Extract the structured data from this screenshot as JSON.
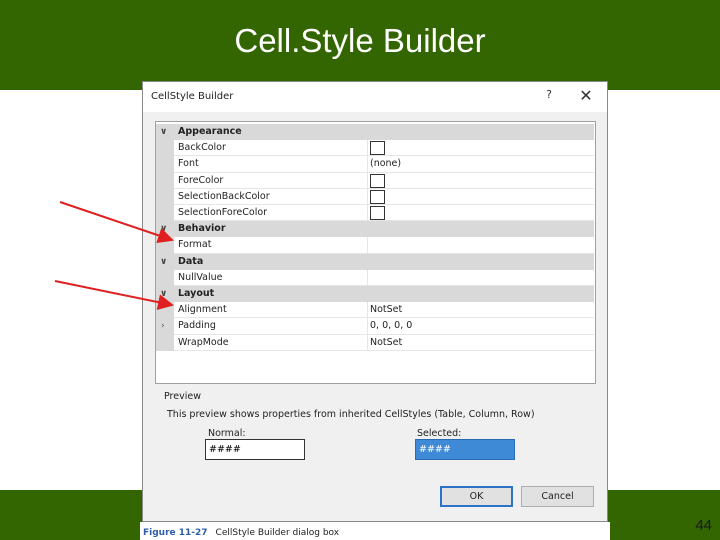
{
  "slide": {
    "title": "Cell.Style Builder",
    "number": "44"
  },
  "caption": {
    "figure": "Figure 11-27",
    "text": "CellStyle Builder dialog box"
  },
  "dialog": {
    "title": "CellStyle Builder",
    "help": "?",
    "close": "✕"
  },
  "categories": {
    "appearance": "Appearance",
    "behavior": "Behavior",
    "data": "Data",
    "layout": "Layout"
  },
  "properties": {
    "backcolor": {
      "name": "BackColor",
      "value": ""
    },
    "font": {
      "name": "Font",
      "value": "(none)"
    },
    "forecolor": {
      "name": "ForeColor",
      "value": ""
    },
    "selbackcolor": {
      "name": "SelectionBackColor",
      "value": ""
    },
    "selforecolor": {
      "name": "SelectionForeColor",
      "value": ""
    },
    "format": {
      "name": "Format",
      "value": ""
    },
    "nullvalue": {
      "name": "NullValue",
      "value": ""
    },
    "alignment": {
      "name": "Alignment",
      "value": "NotSet"
    },
    "padding": {
      "name": "Padding",
      "value": "0, 0, 0, 0"
    },
    "wrapmode": {
      "name": "WrapMode",
      "value": "NotSet"
    }
  },
  "preview": {
    "label": "Preview",
    "description": "This preview shows properties from inherited CellStyles (Table, Column, Row)",
    "normal_label": "Normal:",
    "normal_value": "####",
    "selected_label": "Selected:",
    "selected_value": "####"
  },
  "buttons": {
    "ok": "OK",
    "cancel": "Cancel"
  },
  "colors": {
    "band": "#336600",
    "selected": "#3e8ad6",
    "arrow": "#e02020"
  }
}
